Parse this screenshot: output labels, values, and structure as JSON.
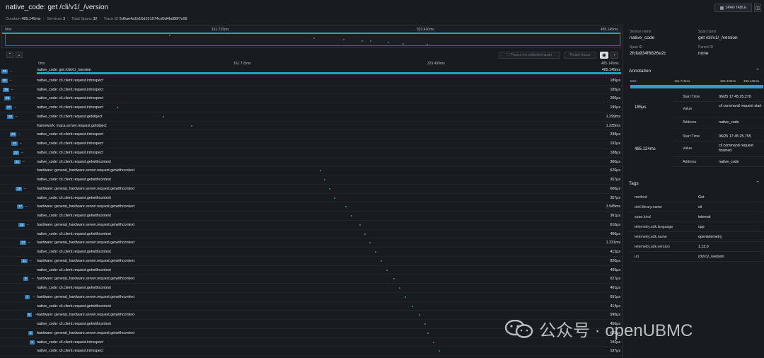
{
  "header": {
    "title": "native_code: get /cli/v1/_/version",
    "span_table_label": "SPAN TABLE"
  },
  "meta": {
    "duration_label": "Duration",
    "duration": "485.145ms",
    "services_label": "Services",
    "services": "3",
    "spans_label": "Total Spans",
    "spans": "32",
    "trace_label": "Trace ID",
    "trace_id": "5d6ae4a1b16d151074cd0d4bd88f7c68"
  },
  "minimap": {
    "ticks": [
      "0ms",
      "161.715ms",
      "323.430ms",
      "485.145ms"
    ]
  },
  "controls": {
    "focus": "Focus on selected span",
    "reset": "Reset focus"
  },
  "axis": {
    "ticks": [
      "0ms",
      "161.715ms",
      "323.430ms",
      "485.145ms"
    ]
  },
  "spans": [
    {
      "n": "31",
      "name": "native_code: get /cli/v1/_/version",
      "dur": "485.145ms"
    },
    {
      "n": "30",
      "name": "native_code: cli.client.request.introspect",
      "dur": "189μs"
    },
    {
      "n": "29",
      "name": "native_code: cli.client.request.introspect",
      "dur": "185μs"
    },
    {
      "n": "28",
      "name": "native_code: cli.client.request.introspect",
      "dur": "206μs"
    },
    {
      "n": "27",
      "name": "native_code: cli.client.request.introspect",
      "dur": "195μs"
    },
    {
      "n": "26",
      "name": "native_code: cli.client.request.getobject",
      "dur": "1.299ms"
    },
    {
      "n": "",
      "name": "framework: maca.server.request.getobject",
      "dur": "1.235ms"
    },
    {
      "n": "24",
      "name": "native_code: cli.client.request.introspect",
      "dur": "238μs"
    },
    {
      "n": "23",
      "name": "native_code: cli.client.request.introspect",
      "dur": "192μs"
    },
    {
      "n": "22",
      "name": "native_code: cli.client.request.introspect",
      "dur": "188μs"
    },
    {
      "n": "21",
      "name": "native_code: cli.client.request.getwithcontext",
      "dur": "360μs"
    },
    {
      "n": "",
      "name": "hardware: general_hardware.server.request.getwithcontext",
      "dur": "620μs"
    },
    {
      "n": "",
      "name": "native_code: cli.client.request.getwithcontext",
      "dur": "357μs"
    },
    {
      "n": "19",
      "name": "hardware: general_hardware.server.request.getwithcontext",
      "dur": "606μs"
    },
    {
      "n": "",
      "name": "native_code: cli.client.request.getwithcontext",
      "dur": "357μs"
    },
    {
      "n": "17",
      "name": "hardware: general_hardware.server.request.getwithcontext",
      "dur": "1.545ms"
    },
    {
      "n": "",
      "name": "native_code: cli.client.request.getwithcontext",
      "dur": "361μs"
    },
    {
      "n": "15",
      "name": "hardware: general_hardware.server.request.getwithcontext",
      "dur": "610μs"
    },
    {
      "n": "",
      "name": "native_code: cli.client.request.getwithcontext",
      "dur": "406μs"
    },
    {
      "n": "13",
      "name": "hardware: general_hardware.server.request.getwithcontext",
      "dur": "1.231ms"
    },
    {
      "n": "",
      "name": "native_code: cli.client.request.getwithcontext",
      "dur": "412μs"
    },
    {
      "n": "11",
      "name": "hardware: general_hardware.server.request.getwithcontext",
      "dur": "820μs"
    },
    {
      "n": "",
      "name": "native_code: cli.client.request.getwithcontext",
      "dur": "405μs"
    },
    {
      "n": "9",
      "name": "hardware: general_hardware.server.request.getwithcontext",
      "dur": "627μs"
    },
    {
      "n": "",
      "name": "native_code: cli.client.request.getwithcontext",
      "dur": "401μs"
    },
    {
      "n": "7",
      "name": "hardware: general_hardware.server.request.getwithcontext",
      "dur": "691μs"
    },
    {
      "n": "",
      "name": "native_code: cli.client.request.getwithcontext",
      "dur": "414μs"
    },
    {
      "n": "5",
      "name": "hardware: general_hardware.server.request.getwithcontext",
      "dur": "990μs"
    },
    {
      "n": "",
      "name": "native_code: cli.client.request.getwithcontext",
      "dur": "456μs"
    },
    {
      "n": "3",
      "name": "hardware: general_hardware.server.request.getwithcontext",
      "dur": "625μs"
    },
    {
      "n": "1",
      "name": "native_code: cli.client.request.introspect",
      "dur": "192μs"
    },
    {
      "n": "",
      "name": "native_code: cli.client.request.introspect",
      "dur": "197μs"
    }
  ],
  "details": {
    "service_name_label": "Service name",
    "service_name": "native_code",
    "span_name_label": "Span name",
    "span_name": "get /cli/v1/_/version",
    "span_id_label": "Span ID",
    "span_id": "2fcfa934f6826e2c",
    "parent_id_label": "Parent ID",
    "parent_id": "none"
  },
  "annotation": {
    "title": "Annotation",
    "axis": [
      "0ms",
      "161.715ms",
      "323.430ms",
      "485.145ms"
    ],
    "items": [
      {
        "offset": "185μs",
        "start_label": "Start Time",
        "start": "06/25 17:45:25.270",
        "value_label": "Value",
        "value": "cli command request start",
        "address_label": "Address",
        "address": "native_code"
      },
      {
        "offset": "485.124ms",
        "start_label": "Start Time",
        "start": "06/25 17:45:25.755",
        "value_label": "Value",
        "value": "cli command request finished",
        "address_label": "Address",
        "address": "native_code"
      }
    ]
  },
  "tags": {
    "title": "Tags",
    "rows": [
      {
        "k": "method",
        "v": "Get"
      },
      {
        "k": "otel.library.name",
        "v": "cli"
      },
      {
        "k": "span.kind",
        "v": "internal"
      },
      {
        "k": "telemetry.sdk.language",
        "v": "cpp"
      },
      {
        "k": "telemetry.sdk.name",
        "v": "opentelemetry"
      },
      {
        "k": "telemetry.sdk.version",
        "v": "1.13.0"
      },
      {
        "k": "uri",
        "v": "/cli/v1/_/version"
      }
    ]
  },
  "watermark": {
    "text": "公众号 · openUBMC"
  }
}
